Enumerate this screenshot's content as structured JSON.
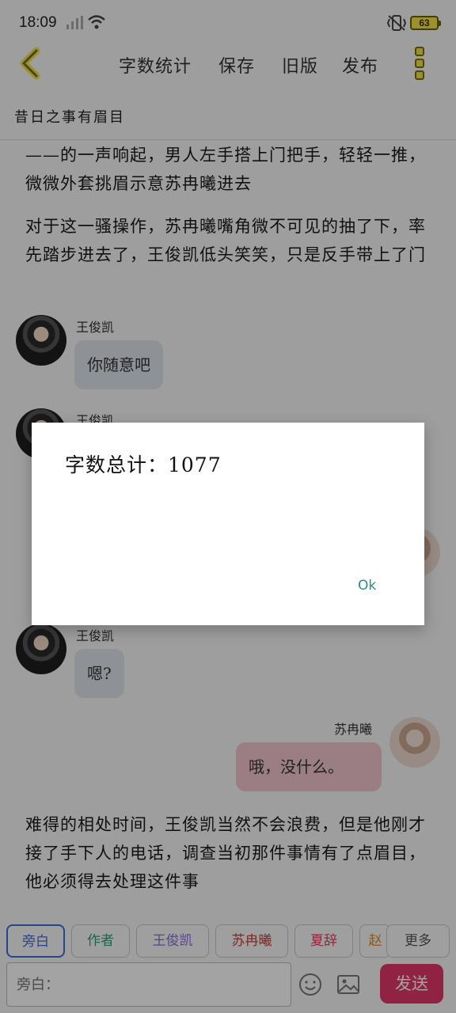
{
  "status": {
    "time": "18:09",
    "battery": "63"
  },
  "toolbar": {
    "items": [
      "字数统计",
      "保存",
      "旧版",
      "发布"
    ]
  },
  "chapter_title": "昔日之事有眉目",
  "story": {
    "p1": "——的一声响起，男人左手搭上门把手，轻轻一推，微微外套挑眉示意苏冉曦进去",
    "p2": "对于这一骚操作，苏冉曦嘴角微不可见的抽了下，率先踏步进去了，王俊凯低头笑笑，只是反手带上了门",
    "msg1_speaker": "王俊凯",
    "msg1_text": "你随意吧",
    "msg2_speaker": "王俊凯",
    "msg3_speaker": "王俊凯",
    "msg3_text": "嗯?",
    "msg4_speaker": "苏冉曦",
    "msg4_text": "哦，没什么。",
    "p3": "难得的相处时间，王俊凯当然不会浪费，但是他刚才接了手下人的电话，调查当初那件事情有了点眉目，他必须得去处理这件事"
  },
  "dialog": {
    "message": "字数总计：1077",
    "ok": "Ok"
  },
  "roles": {
    "items": [
      "旁白",
      "作者",
      "王俊凯",
      "苏冉曦",
      "夏辞",
      "赵",
      "更多"
    ],
    "colors": [
      "#3f6dd6",
      "#2aa07a",
      "#8b6ad8",
      "#c43d3d",
      "#e23d5b",
      "#e08a2a",
      "#555555"
    ]
  },
  "composer": {
    "placeholder": "旁白：",
    "send": "发送"
  },
  "icons": [
    "back-arrow-icon",
    "more-vertical-icon",
    "signal-icon",
    "wifi-icon",
    "vibrate-icon",
    "battery-icon",
    "emoji-icon",
    "image-icon"
  ]
}
